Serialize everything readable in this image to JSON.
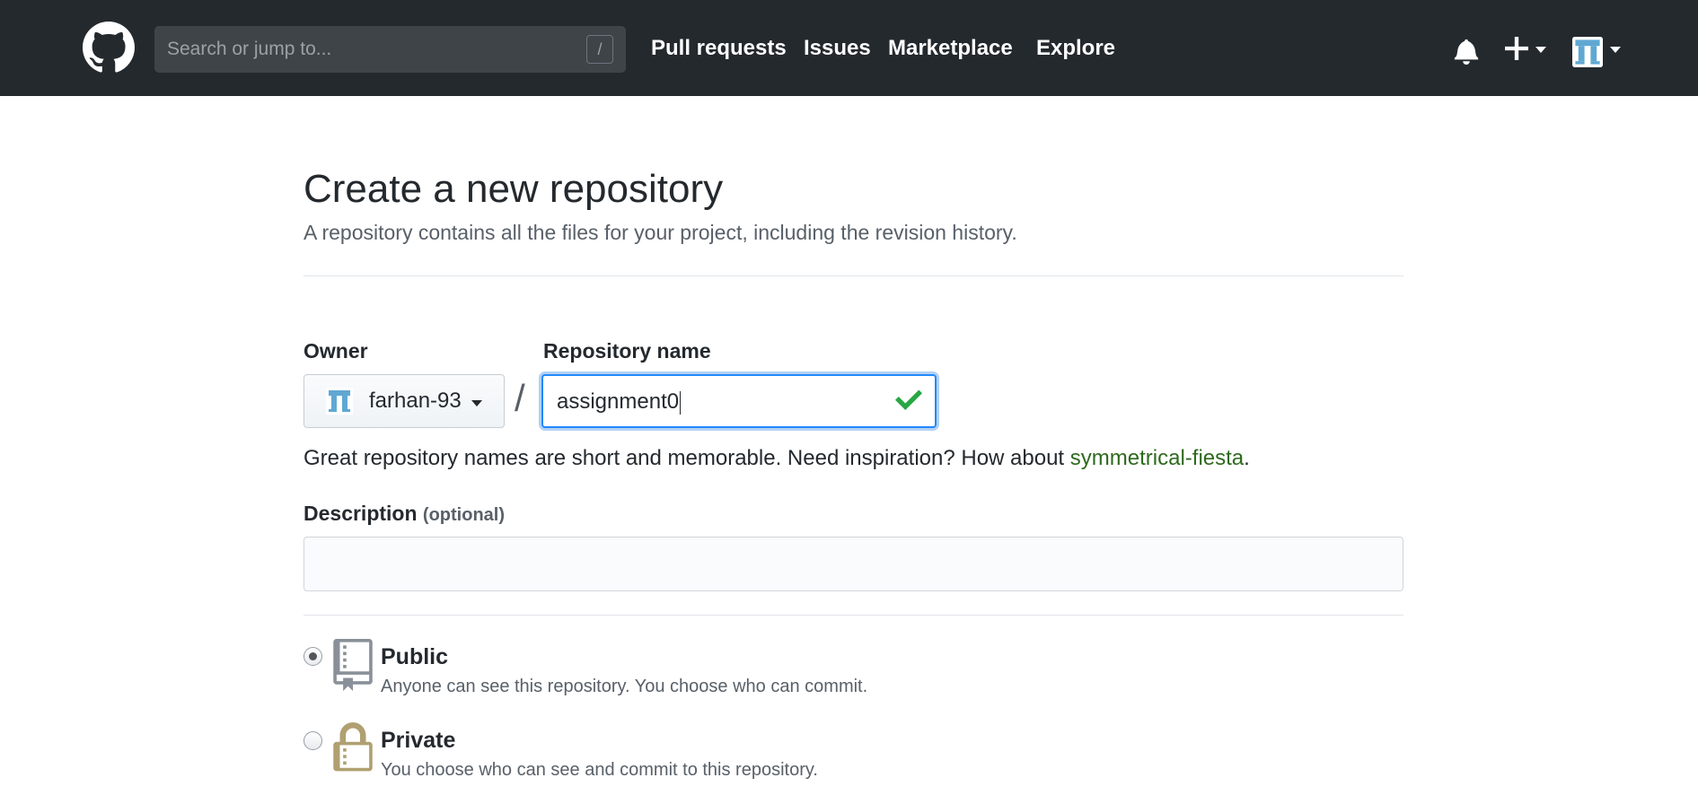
{
  "header": {
    "search_placeholder": "Search or jump to...",
    "search_shortcut": "/",
    "nav": [
      "Pull requests",
      "Issues",
      "Marketplace",
      "Explore"
    ]
  },
  "page": {
    "title": "Create a new repository",
    "subtitle": "A repository contains all the files for your project, including the revision history."
  },
  "form": {
    "owner_label": "Owner",
    "owner_value": "farhan-93",
    "separator": "/",
    "repo_label": "Repository name",
    "repo_value": "assignment0",
    "hint_text": "Great repository names are short and memorable. Need inspiration? How about ",
    "hint_suggestion": "symmetrical-fiesta",
    "hint_end": ".",
    "description_label": "Description",
    "description_optional": "(optional)",
    "description_value": ""
  },
  "visibility": {
    "selected": "public",
    "public_title": "Public",
    "public_desc": "Anyone can see this repository. You choose who can commit.",
    "private_title": "Private",
    "private_desc": "You choose who can see and commit to this repository."
  },
  "colors": {
    "header_bg": "#24292e",
    "link_green": "#2e6a1e",
    "focus_blue": "#2188ff",
    "valid_check": "#28a745",
    "lock_gold": "#b0a071"
  },
  "icons": {
    "logo": "github-octocat-icon",
    "bell": "bell-icon",
    "plus": "plus-icon",
    "check": "check-icon",
    "repo": "repo-book-icon",
    "lock": "lock-icon"
  }
}
